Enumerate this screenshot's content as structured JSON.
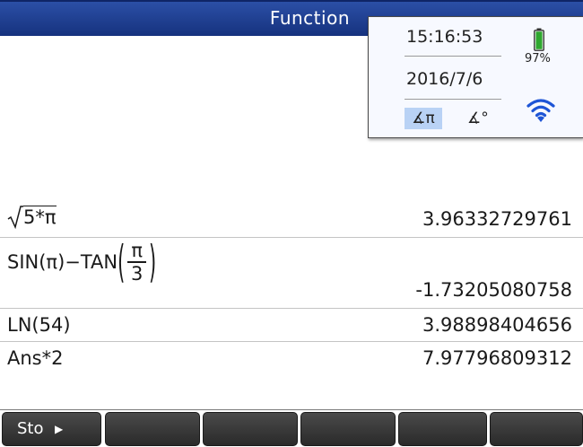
{
  "app": {
    "title": "Function"
  },
  "status": {
    "time": "15:16:53",
    "date": "2016/7/6",
    "battery_percent": "97%",
    "battery_color": "#2fa82f",
    "wifi_color": "#1e55d6",
    "angle_rad_label": "∡π",
    "angle_deg_label": "∡°",
    "angle_selected": "radians"
  },
  "history": [
    {
      "expr": "5*π",
      "result": "3.96332729761",
      "kind": "sqrt"
    },
    {
      "expr_prefix": "SIN(π)−TAN",
      "frac_num": "π",
      "frac_den": "3",
      "result": "-1.73205080758",
      "kind": "fraction"
    },
    {
      "expr": "LN(54)",
      "result": "3.98898404656",
      "kind": "plain"
    },
    {
      "expr": "Ans*2",
      "result": "7.97796809312",
      "kind": "plain"
    }
  ],
  "entry": {
    "value": ""
  },
  "menu": {
    "keys": [
      {
        "label": "Sto",
        "has_submenu": true
      },
      {
        "label": ""
      },
      {
        "label": ""
      },
      {
        "label": ""
      },
      {
        "label": ""
      },
      {
        "label": ""
      }
    ]
  }
}
